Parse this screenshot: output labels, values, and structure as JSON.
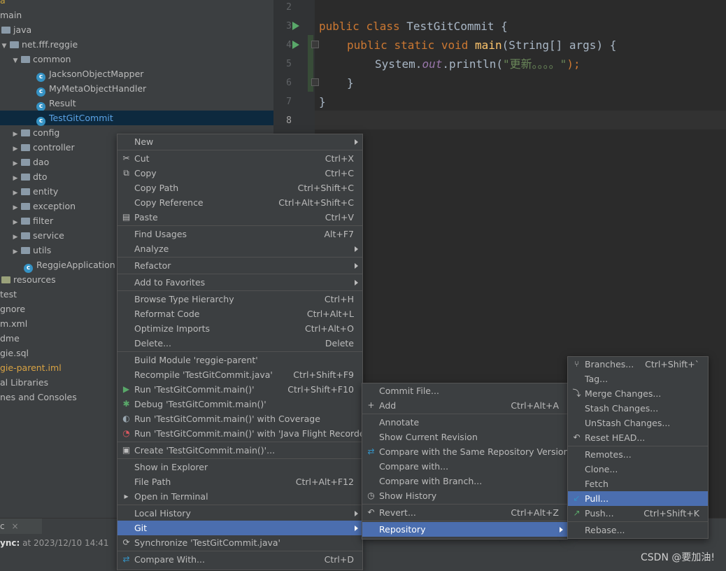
{
  "project_tree": {
    "items": [
      {
        "label": "a",
        "kind": "text",
        "indent": 0
      },
      {
        "label": "main",
        "kind": "folder-partial",
        "indent": 0
      },
      {
        "label": "java",
        "kind": "folder",
        "indent": 0
      },
      {
        "label": "net.fff.reggie",
        "kind": "package",
        "indent": 1
      },
      {
        "label": "common",
        "kind": "package",
        "indent": 2
      },
      {
        "label": "JacksonObjectMapper",
        "kind": "class",
        "indent": 3
      },
      {
        "label": "MyMetaObjectHandler",
        "kind": "class",
        "indent": 3
      },
      {
        "label": "Result",
        "kind": "class",
        "indent": 3
      },
      {
        "label": "TestGitCommit",
        "kind": "class-selected",
        "indent": 3
      },
      {
        "label": "config",
        "kind": "package",
        "indent": 2
      },
      {
        "label": "controller",
        "kind": "package",
        "indent": 2
      },
      {
        "label": "dao",
        "kind": "package",
        "indent": 2
      },
      {
        "label": "dto",
        "kind": "package",
        "indent": 2
      },
      {
        "label": "entity",
        "kind": "package",
        "indent": 2
      },
      {
        "label": "exception",
        "kind": "package",
        "indent": 2
      },
      {
        "label": "filter",
        "kind": "package",
        "indent": 2
      },
      {
        "label": "service",
        "kind": "package",
        "indent": 2
      },
      {
        "label": "utils",
        "kind": "package",
        "indent": 2
      },
      {
        "label": "ReggieApplication",
        "kind": "app",
        "indent": 2
      },
      {
        "label": "resources",
        "kind": "resources",
        "indent": 0
      },
      {
        "label": "test",
        "kind": "text",
        "indent": 0
      },
      {
        "label": "gnore",
        "kind": "text",
        "indent": 0
      },
      {
        "label": "m.xml",
        "kind": "text",
        "indent": 0
      },
      {
        "label": "dme",
        "kind": "text",
        "indent": 0
      },
      {
        "label": "gie.sql",
        "kind": "text",
        "indent": 0
      },
      {
        "label": "gie-parent.iml",
        "kind": "text-orange",
        "indent": 0
      },
      {
        "label": "al Libraries",
        "kind": "text",
        "indent": 0
      },
      {
        "label": "nes and Consoles",
        "kind": "text",
        "indent": 0
      }
    ]
  },
  "editor": {
    "line_numbers": [
      "2",
      "3",
      "4",
      "5",
      "6",
      "7",
      "8"
    ],
    "code": {
      "l3": {
        "kw1": "public",
        "kw2": "class",
        "name": "TestGitCommit",
        "brace": " {"
      },
      "l4": {
        "kw1": "public",
        "kw2": "static",
        "kw3": "void",
        "fn": "main",
        "params": "(String[] args) {"
      },
      "l5": {
        "obj": "System.",
        "field": "out",
        "call": ".println(",
        "str": "\"更新。。。。\"",
        "end": ");"
      },
      "l6": "}",
      "l7": "}"
    }
  },
  "context_menu": {
    "items": [
      {
        "label": "New",
        "shortcut": "",
        "submenu": true,
        "icon": ""
      },
      {
        "sep": true
      },
      {
        "label": "Cut",
        "shortcut": "Ctrl+X",
        "icon": "scissors-icon"
      },
      {
        "label": "Copy",
        "shortcut": "Ctrl+C",
        "icon": "copy-icon"
      },
      {
        "label": "Copy Path",
        "shortcut": "Ctrl+Shift+C"
      },
      {
        "label": "Copy Reference",
        "shortcut": "Ctrl+Alt+Shift+C"
      },
      {
        "label": "Paste",
        "shortcut": "Ctrl+V",
        "icon": "clipboard-icon"
      },
      {
        "sep": true
      },
      {
        "label": "Find Usages",
        "shortcut": "Alt+F7"
      },
      {
        "label": "Analyze",
        "submenu": true
      },
      {
        "sep": true
      },
      {
        "label": "Refactor",
        "submenu": true
      },
      {
        "sep": true
      },
      {
        "label": "Add to Favorites",
        "submenu": true
      },
      {
        "sep": true
      },
      {
        "label": "Browse Type Hierarchy",
        "shortcut": "Ctrl+H"
      },
      {
        "label": "Reformat Code",
        "shortcut": "Ctrl+Alt+L"
      },
      {
        "label": "Optimize Imports",
        "shortcut": "Ctrl+Alt+O"
      },
      {
        "label": "Delete...",
        "shortcut": "Delete"
      },
      {
        "sep": true
      },
      {
        "label": "Build Module 'reggie-parent'",
        "shortcut": ""
      },
      {
        "label": "Recompile 'TestGitCommit.java'",
        "shortcut": "Ctrl+Shift+F9"
      },
      {
        "label": "Run 'TestGitCommit.main()'",
        "shortcut": "Ctrl+Shift+F10",
        "icon": "run-icon"
      },
      {
        "label": "Debug 'TestGitCommit.main()'",
        "icon": "debug-icon"
      },
      {
        "label": "Run 'TestGitCommit.main()' with Coverage",
        "icon": "coverage-icon"
      },
      {
        "label": "Run 'TestGitCommit.main()' with 'Java Flight Recorder'",
        "icon": "flight-recorder-icon"
      },
      {
        "sep": true
      },
      {
        "label": "Create 'TestGitCommit.main()'...",
        "icon": "create-config-icon"
      },
      {
        "sep": true
      },
      {
        "label": "Show in Explorer"
      },
      {
        "label": "File Path",
        "shortcut": "Ctrl+Alt+F12"
      },
      {
        "label": "Open in Terminal",
        "icon": "terminal-icon"
      },
      {
        "sep": true
      },
      {
        "label": "Local History",
        "submenu": true
      },
      {
        "label": "Git",
        "submenu": true,
        "highlight": true
      },
      {
        "label": "Synchronize 'TestGitCommit.java'",
        "icon": "sync-icon"
      },
      {
        "sep": true
      },
      {
        "label": "Compare With...",
        "shortcut": "Ctrl+D",
        "icon": "compare-icon"
      }
    ]
  },
  "git_menu": {
    "items": [
      {
        "label": "Commit File..."
      },
      {
        "label": "Add",
        "shortcut": "Ctrl+Alt+A",
        "icon": "plus-icon"
      },
      {
        "sep": true
      },
      {
        "label": "Annotate"
      },
      {
        "label": "Show Current Revision"
      },
      {
        "label": "Compare with the Same Repository Version",
        "icon": "compare-icon"
      },
      {
        "label": "Compare with..."
      },
      {
        "label": "Compare with Branch..."
      },
      {
        "label": "Show History",
        "icon": "clock-icon"
      },
      {
        "sep": true
      },
      {
        "label": "Revert...",
        "shortcut": "Ctrl+Alt+Z",
        "icon": "revert-icon"
      },
      {
        "sep": true
      },
      {
        "label": "Repository",
        "submenu": true,
        "highlight": true
      }
    ]
  },
  "repository_menu": {
    "items": [
      {
        "label": "Branches...",
        "shortcut": "Ctrl+Shift+`",
        "icon": "branch-icon"
      },
      {
        "label": "Tag..."
      },
      {
        "label": "Merge Changes...",
        "icon": "merge-icon"
      },
      {
        "label": "Stash Changes..."
      },
      {
        "label": "UnStash Changes..."
      },
      {
        "label": "Reset HEAD...",
        "icon": "reset-icon"
      },
      {
        "sep": true
      },
      {
        "label": "Remotes..."
      },
      {
        "label": "Clone..."
      },
      {
        "label": "Fetch"
      },
      {
        "label": "Pull...",
        "highlight": true,
        "icon": "pull-icon"
      },
      {
        "label": "Push...",
        "shortcut": "Ctrl+Shift+K",
        "icon": "push-icon"
      },
      {
        "sep": true
      },
      {
        "label": "Rebase..."
      }
    ]
  },
  "bottom": {
    "tab_label": "c",
    "tab_close": "×",
    "sync_label": "ync:",
    "sync_time": "at 2023/12/10 14:41"
  },
  "watermark": "CSDN @要加油!"
}
